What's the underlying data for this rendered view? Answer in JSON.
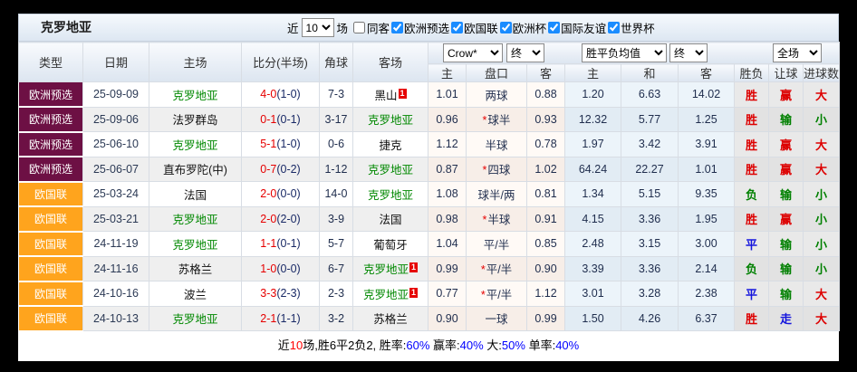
{
  "toolbar": {
    "team": "克罗地亚",
    "near_label": "近",
    "matches_selected": "10",
    "matches_label": "场",
    "same_venue_label": "同客",
    "same_venue_checked": false,
    "league_filters": [
      {
        "label": "欧洲预选",
        "checked": true
      },
      {
        "label": "欧国联",
        "checked": true
      },
      {
        "label": "欧洲杯",
        "checked": true
      },
      {
        "label": "国际友谊",
        "checked": true
      },
      {
        "label": "世界杯",
        "checked": true
      }
    ]
  },
  "table": {
    "left_headers": [
      "类型",
      "日期",
      "主场",
      "比分(半场)",
      "角球",
      "客场"
    ],
    "sub_headers": [
      "主",
      "盘口",
      "客",
      "主",
      "和",
      "客",
      "胜负",
      "让球",
      "进球数"
    ],
    "dropdowns": {
      "odds_source": "Crow*",
      "odds_final": "终",
      "avg": "胜平负均值",
      "avg_final": "终",
      "scope": "全场"
    },
    "rows": [
      {
        "league": "欧洲预选",
        "date": "25-09-09",
        "home": "克罗地亚",
        "home_green": true,
        "home_badge": "",
        "score": "4-0",
        "half": "(1-0)",
        "corner": "7-3",
        "away": "黑山",
        "away_green": false,
        "away_badge": "1",
        "odds_home": "1.01",
        "handicap": "两球",
        "handicap_star": false,
        "odds_away": "0.88",
        "avg_win": "1.20",
        "avg_draw": "6.63",
        "avg_lose": "14.02",
        "result_wdl": "胜",
        "result_handicap": "赢",
        "result_goals": "大"
      },
      {
        "league": "欧洲预选",
        "date": "25-09-06",
        "home": "法罗群岛",
        "home_green": false,
        "home_badge": "",
        "score": "0-1",
        "half": "(0-1)",
        "corner": "3-17",
        "away": "克罗地亚",
        "away_green": true,
        "away_badge": "",
        "odds_home": "0.96",
        "handicap": "球半",
        "handicap_star": true,
        "odds_away": "0.93",
        "avg_win": "12.32",
        "avg_draw": "5.77",
        "avg_lose": "1.25",
        "result_wdl": "胜",
        "result_handicap": "输",
        "result_goals": "小"
      },
      {
        "league": "欧洲预选",
        "date": "25-06-10",
        "home": "克罗地亚",
        "home_green": true,
        "home_badge": "",
        "score": "5-1",
        "half": "(1-0)",
        "corner": "0-6",
        "away": "捷克",
        "away_green": false,
        "away_badge": "",
        "odds_home": "1.12",
        "handicap": "半球",
        "handicap_star": false,
        "odds_away": "0.78",
        "avg_win": "1.97",
        "avg_draw": "3.42",
        "avg_lose": "3.91",
        "result_wdl": "胜",
        "result_handicap": "赢",
        "result_goals": "大"
      },
      {
        "league": "欧洲预选",
        "date": "25-06-07",
        "home": "直布罗陀(中)",
        "home_green": false,
        "home_badge": "",
        "score": "0-7",
        "half": "(0-2)",
        "corner": "1-12",
        "away": "克罗地亚",
        "away_green": true,
        "away_badge": "",
        "odds_home": "0.87",
        "handicap": "四球",
        "handicap_star": true,
        "odds_away": "1.02",
        "avg_win": "64.24",
        "avg_draw": "22.27",
        "avg_lose": "1.01",
        "result_wdl": "胜",
        "result_handicap": "赢",
        "result_goals": "大"
      },
      {
        "league": "欧国联",
        "date": "25-03-24",
        "home": "法国",
        "home_green": false,
        "home_badge": "",
        "score": "2-0",
        "half": "(0-0)",
        "corner": "14-0",
        "away": "克罗地亚",
        "away_green": true,
        "away_badge": "",
        "odds_home": "1.08",
        "handicap": "球半/两",
        "handicap_star": false,
        "odds_away": "0.81",
        "avg_win": "1.34",
        "avg_draw": "5.15",
        "avg_lose": "9.35",
        "result_wdl": "负",
        "result_handicap": "输",
        "result_goals": "小"
      },
      {
        "league": "欧国联",
        "date": "25-03-21",
        "home": "克罗地亚",
        "home_green": true,
        "home_badge": "",
        "score": "2-0",
        "half": "(2-0)",
        "corner": "3-9",
        "away": "法国",
        "away_green": false,
        "away_badge": "",
        "odds_home": "0.98",
        "handicap": "半球",
        "handicap_star": true,
        "odds_away": "0.91",
        "avg_win": "4.15",
        "avg_draw": "3.36",
        "avg_lose": "1.95",
        "result_wdl": "胜",
        "result_handicap": "赢",
        "result_goals": "小"
      },
      {
        "league": "欧国联",
        "date": "24-11-19",
        "home": "克罗地亚",
        "home_green": true,
        "home_badge": "",
        "score": "1-1",
        "half": "(0-1)",
        "corner": "5-7",
        "away": "葡萄牙",
        "away_green": false,
        "away_badge": "",
        "odds_home": "1.04",
        "handicap": "平/半",
        "handicap_star": false,
        "odds_away": "0.85",
        "avg_win": "2.48",
        "avg_draw": "3.15",
        "avg_lose": "3.00",
        "result_wdl": "平",
        "result_handicap": "输",
        "result_goals": "小"
      },
      {
        "league": "欧国联",
        "date": "24-11-16",
        "home": "苏格兰",
        "home_green": false,
        "home_badge": "",
        "score": "1-0",
        "half": "(0-0)",
        "corner": "6-7",
        "away": "克罗地亚",
        "away_green": true,
        "away_badge": "1",
        "odds_home": "0.99",
        "handicap": "平/半",
        "handicap_star": true,
        "odds_away": "0.90",
        "avg_win": "3.39",
        "avg_draw": "3.36",
        "avg_lose": "2.14",
        "result_wdl": "负",
        "result_handicap": "输",
        "result_goals": "小"
      },
      {
        "league": "欧国联",
        "date": "24-10-16",
        "home": "波兰",
        "home_green": false,
        "home_badge": "",
        "score": "3-3",
        "half": "(2-3)",
        "corner": "2-3",
        "away": "克罗地亚",
        "away_green": true,
        "away_badge": "1",
        "odds_home": "0.77",
        "handicap": "平/半",
        "handicap_star": true,
        "odds_away": "1.12",
        "avg_win": "3.01",
        "avg_draw": "3.28",
        "avg_lose": "2.38",
        "result_wdl": "平",
        "result_handicap": "输",
        "result_goals": "大"
      },
      {
        "league": "欧国联",
        "date": "24-10-13",
        "home": "克罗地亚",
        "home_green": true,
        "home_badge": "",
        "score": "2-1",
        "half": "(1-1)",
        "corner": "3-2",
        "away": "苏格兰",
        "away_green": false,
        "away_badge": "",
        "odds_home": "0.90",
        "handicap": "一球",
        "handicap_star": false,
        "odds_away": "0.99",
        "avg_win": "1.50",
        "avg_draw": "4.26",
        "avg_lose": "6.37",
        "result_wdl": "胜",
        "result_handicap": "走",
        "result_goals": "大"
      }
    ]
  },
  "footer": {
    "parts": [
      {
        "text": "近",
        "color": "#000000"
      },
      {
        "text": "10",
        "color": "#ff0000"
      },
      {
        "text": "场,胜6平2负2, 胜率:",
        "color": "#000000"
      },
      {
        "text": "60%",
        "color": "#0000ff"
      },
      {
        "text": " 赢率:",
        "color": "#000000"
      },
      {
        "text": "40%",
        "color": "#0000ff"
      },
      {
        "text": " 大:",
        "color": "#000000"
      },
      {
        "text": "50%",
        "color": "#0000ff"
      },
      {
        "text": " 单率:",
        "color": "#000000"
      },
      {
        "text": "40%",
        "color": "#0000ff"
      }
    ]
  },
  "colors": {
    "league": {
      "欧洲预选": "#6d1044",
      "欧国联": "#ffa41d"
    },
    "result": {
      "胜": "#dd0000",
      "负": "#008000",
      "平": "#1414dd",
      "赢": "#dd0000",
      "输": "#008000",
      "走": "#1414dd",
      "大": "#dd0000",
      "小": "#008000"
    },
    "team_green": "#008800",
    "score_red": "#e60000",
    "half_navy": "#1a2a66",
    "checkbox_accent": "#1a8cff",
    "badge_red": "#e60000"
  }
}
